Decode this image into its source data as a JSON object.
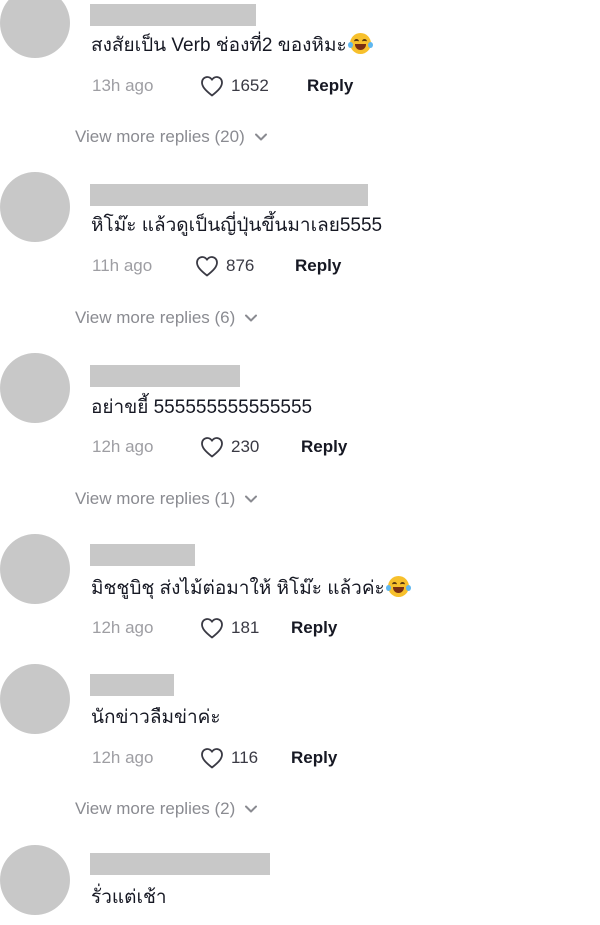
{
  "comments": [
    {
      "text": "สงสัยเป็น Verb ช่องที่2 ของหิมะ",
      "has_emoji": true,
      "emoji": "face-with-tears-of-joy",
      "time": "13h ago",
      "likes": "1652",
      "reply_label": "Reply",
      "view_more": "View more replies (20)"
    },
    {
      "text": "หิโม๊ะ แล้วดูเป็นญี่ปุ่นขึ้นมาเลย5555",
      "has_emoji": false,
      "time": "11h ago",
      "likes": "876",
      "reply_label": "Reply",
      "view_more": "View more replies (6)"
    },
    {
      "text": "อย่าขยี้ 555555555555555",
      "has_emoji": false,
      "time": "12h ago",
      "likes": "230",
      "reply_label": "Reply",
      "view_more": "View more replies (1)"
    },
    {
      "text": "มิชชูบิชุ ส่งไม้ต่อมาให้ หิโม๊ะ แล้วค่ะ",
      "has_emoji": true,
      "emoji": "face-with-tears-of-joy",
      "time": "12h ago",
      "likes": "181",
      "reply_label": "Reply",
      "view_more": ""
    },
    {
      "text": "นักข่าวลืมข่าค่ะ",
      "has_emoji": false,
      "time": "12h ago",
      "likes": "116",
      "reply_label": "Reply",
      "view_more": "View more replies (2)"
    },
    {
      "text": "รั่วแต่เช้า",
      "has_emoji": false,
      "time": "",
      "likes": "",
      "reply_label": "",
      "view_more": ""
    }
  ],
  "colors": {
    "avatar_placeholder": "#c8c8c8",
    "muted_text": "#9e9ea3",
    "view_more_text": "#8a8b91",
    "primary_text": "#161823"
  },
  "icons": {
    "like": "heart-outline-icon",
    "expand": "chevron-down-icon"
  }
}
